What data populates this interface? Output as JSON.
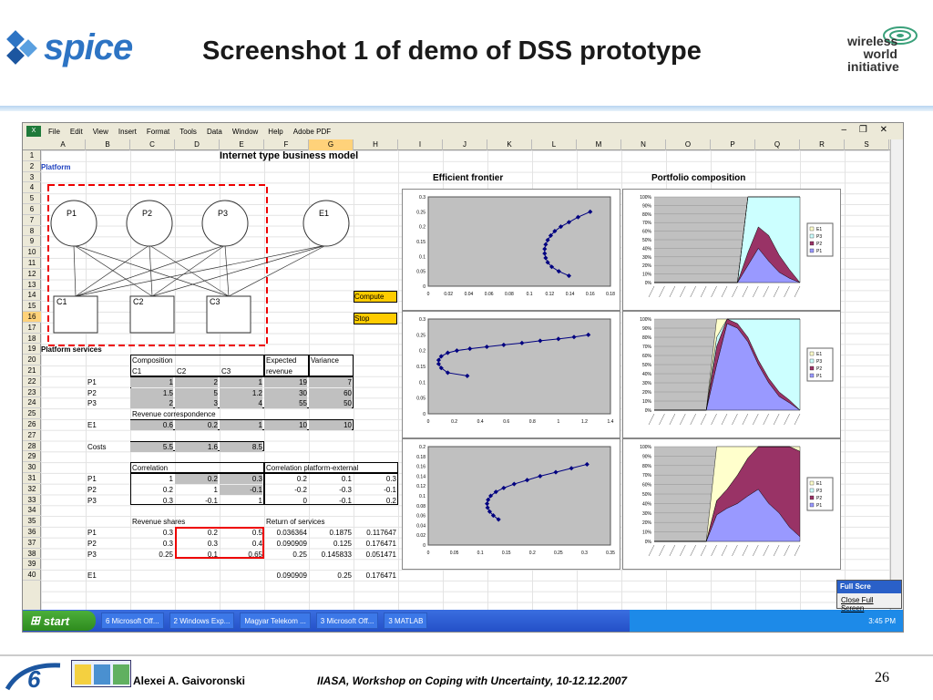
{
  "slide": {
    "title": "Screenshot 1 of demo of DSS prototype",
    "spice_logo": "spice",
    "wwi_logo": [
      "wireless",
      "world",
      "initiative"
    ],
    "author": "Alexei A. Gaivoronski",
    "venue": "IIASA, Workshop on Coping with Uncertainty, 10-12.12.2007",
    "page_number": "26"
  },
  "excel": {
    "menu": [
      "File",
      "Edit",
      "View",
      "Insert",
      "Format",
      "Tools",
      "Data",
      "Window",
      "Help",
      "Adobe PDF"
    ],
    "columns": [
      "A",
      "B",
      "C",
      "D",
      "E",
      "F",
      "G",
      "H",
      "I",
      "J",
      "K",
      "L",
      "M",
      "N",
      "O",
      "P",
      "Q",
      "R",
      "S"
    ],
    "rows": [
      "1",
      "2",
      "3",
      "4",
      "5",
      "6",
      "7",
      "8",
      "9",
      "10",
      "11",
      "12",
      "13",
      "14",
      "15",
      "16",
      "17",
      "18",
      "19",
      "20",
      "21",
      "22",
      "23",
      "24",
      "25",
      "26",
      "27",
      "28",
      "29",
      "30",
      "31",
      "32",
      "33",
      "34",
      "35",
      "36",
      "37",
      "38",
      "39",
      "40"
    ],
    "sheet_title": "Internet type business model",
    "platform_label": "Platform",
    "nodes": {
      "p1": "P1",
      "p2": "P2",
      "p3": "P3",
      "e1": "E1",
      "c1": "C1",
      "c2": "C2",
      "c3": "C3"
    },
    "compute_button": "Compute",
    "stop_button": "Stop",
    "platform_services": "Platform services",
    "composition": "Composition",
    "expected": "Expected",
    "revenue": "revenue",
    "variance": "Variance",
    "comp_cols": [
      "C1",
      "C2",
      "C3"
    ],
    "comp_rows": [
      {
        "label": "P1",
        "vals": [
          "1",
          "2",
          "1"
        ],
        "exp": "19",
        "var": "7"
      },
      {
        "label": "P2",
        "vals": [
          "1.5",
          "5",
          "1.2"
        ],
        "exp": "30",
        "var": "60"
      },
      {
        "label": "P3",
        "vals": [
          "2",
          "3",
          "4"
        ],
        "exp": "55",
        "var": "50"
      }
    ],
    "revenue_correspondence": "Revenue correspondence",
    "e1_row": {
      "label": "E1",
      "vals": [
        "0.6",
        "0.2",
        "1"
      ],
      "exp": "10",
      "var": "10"
    },
    "costs_row": {
      "label": "Costs",
      "vals": [
        "5.5",
        "1.6",
        "8.5"
      ]
    },
    "correlation": "Correlation",
    "correlation_pe": "Correlation platform-external",
    "corr_rows": [
      {
        "label": "P1",
        "vals": [
          "1",
          "0.2",
          "0.3"
        ],
        "ext": [
          "0.2",
          "0.1",
          "0.3"
        ]
      },
      {
        "label": "P2",
        "vals": [
          "0.2",
          "1",
          "-0.1"
        ],
        "ext": [
          "-0.2",
          "-0.3",
          "-0.1"
        ]
      },
      {
        "label": "P3",
        "vals": [
          "0.3",
          "-0.1",
          "1"
        ],
        "ext": [
          "0",
          "-0.1",
          "0.2"
        ]
      }
    ],
    "revenue_shares": "Revenue shares",
    "return_of_services": "Return of services",
    "share_rows": [
      {
        "label": "P1",
        "vals": [
          "0.3",
          "0.2",
          "0.5"
        ],
        "ret": [
          "0.036364",
          "0.1875",
          "0.117647"
        ]
      },
      {
        "label": "P2",
        "vals": [
          "0.3",
          "0.3",
          "0.4"
        ],
        "ret": [
          "0.090909",
          "0.125",
          "0.176471"
        ]
      },
      {
        "label": "P3",
        "vals": [
          "0.25",
          "0.1",
          "0.65"
        ],
        "ret": [
          "0.25",
          "0.145833",
          "0.051471"
        ]
      }
    ],
    "e1_return": {
      "label": "E1",
      "ret": [
        "0.090909",
        "0.25",
        "0.176471"
      ]
    },
    "efficient_frontier_title": "Efficient frontier",
    "portfolio_title": "Portfolio composition",
    "legend": [
      "E1",
      "P3",
      "P2",
      "P1"
    ],
    "colors": {
      "e1": "#ffffcc",
      "p3": "#ccffff",
      "p2": "#993366",
      "p1": "#9999ff",
      "plot_bg": "#c0c0c0",
      "curve": "#000080"
    }
  },
  "chart_data": [
    {
      "type": "scatter",
      "title": "Efficient frontier",
      "xlim": [
        0,
        0.18
      ],
      "ylim": [
        0,
        0.3
      ],
      "x_ticks": [
        "0",
        "0.02",
        "0.04",
        "0.06",
        "0.08",
        "0.1",
        "0.12",
        "0.14",
        "0.16",
        "0.18"
      ],
      "y_ticks": [
        "0",
        "0.05",
        "0.1",
        "0.15",
        "0.2",
        "0.25",
        "0.3"
      ],
      "x": [
        0.139,
        0.129,
        0.122,
        0.118,
        0.116,
        0.115,
        0.115,
        0.116,
        0.118,
        0.121,
        0.125,
        0.131,
        0.139,
        0.148,
        0.16
      ],
      "y": [
        0.035,
        0.05,
        0.065,
        0.08,
        0.095,
        0.11,
        0.125,
        0.14,
        0.155,
        0.17,
        0.185,
        0.2,
        0.215,
        0.232,
        0.25
      ]
    },
    {
      "type": "scatter",
      "xlim": [
        0,
        1.4
      ],
      "ylim": [
        0,
        0.3
      ],
      "x_ticks": [
        "0",
        "0.2",
        "0.4",
        "0.6",
        "0.8",
        "1",
        "1.2",
        "1.4"
      ],
      "y_ticks": [
        "0",
        "0.05",
        "0.1",
        "0.15",
        "0.2",
        "0.25",
        "0.3"
      ],
      "x": [
        0.3,
        0.15,
        0.1,
        0.08,
        0.08,
        0.1,
        0.15,
        0.22,
        0.32,
        0.45,
        0.58,
        0.72,
        0.86,
        1.0,
        1.12,
        1.23
      ],
      "y": [
        0.12,
        0.13,
        0.145,
        0.158,
        0.17,
        0.182,
        0.193,
        0.2,
        0.206,
        0.212,
        0.218,
        0.224,
        0.231,
        0.237,
        0.243,
        0.25
      ]
    },
    {
      "type": "scatter",
      "xlim": [
        0,
        0.35
      ],
      "ylim": [
        0,
        0.2
      ],
      "x_ticks": [
        "0",
        "0.05",
        "0.1",
        "0.15",
        "0.2",
        "0.25",
        "0.3",
        "0.35"
      ],
      "y_ticks": [
        "0",
        "0.02",
        "0.04",
        "0.06",
        "0.08",
        "0.1",
        "0.12",
        "0.14",
        "0.16",
        "0.18",
        "0.2"
      ],
      "x": [
        0.135,
        0.125,
        0.118,
        0.114,
        0.113,
        0.115,
        0.12,
        0.13,
        0.145,
        0.165,
        0.19,
        0.215,
        0.245,
        0.275,
        0.305
      ],
      "y": [
        0.052,
        0.06,
        0.068,
        0.076,
        0.084,
        0.092,
        0.1,
        0.108,
        0.116,
        0.124,
        0.132,
        0.14,
        0.148,
        0.156,
        0.164
      ]
    },
    {
      "type": "area",
      "ylim": [
        0,
        100
      ],
      "y_ticks": [
        "0%",
        "10%",
        "20%",
        "30%",
        "40%",
        "50%",
        "60%",
        "70%",
        "80%",
        "90%",
        "100%"
      ],
      "series": [
        {
          "name": "P1",
          "values": [
            0,
            0,
            0,
            0,
            0,
            0,
            0,
            0,
            0,
            20,
            40,
            25,
            12,
            5,
            0
          ]
        },
        {
          "name": "P2",
          "values": [
            0,
            0,
            0,
            0,
            0,
            0,
            0,
            0,
            0,
            15,
            25,
            30,
            20,
            10,
            0
          ]
        },
        {
          "name": "P3",
          "values": [
            0,
            0,
            0,
            0,
            0,
            0,
            0,
            0,
            0,
            65,
            35,
            45,
            68,
            85,
            100
          ]
        },
        {
          "name": "E1",
          "values": [
            0,
            0,
            0,
            0,
            0,
            0,
            0,
            0,
            0,
            0,
            0,
            0,
            0,
            0,
            0
          ]
        }
      ]
    },
    {
      "type": "area",
      "ylim": [
        0,
        100
      ],
      "y_ticks": [
        "0%",
        "10%",
        "20%",
        "30%",
        "40%",
        "50%",
        "60%",
        "70%",
        "80%",
        "90%",
        "100%"
      ],
      "series": [
        {
          "name": "P1",
          "values": [
            0,
            0,
            0,
            0,
            0,
            0,
            50,
            95,
            90,
            75,
            50,
            30,
            15,
            8,
            0
          ]
        },
        {
          "name": "P2",
          "values": [
            0,
            0,
            0,
            0,
            0,
            0,
            20,
            5,
            5,
            5,
            5,
            5,
            5,
            3,
            0
          ]
        },
        {
          "name": "P3",
          "values": [
            0,
            0,
            0,
            0,
            0,
            0,
            10,
            0,
            5,
            20,
            45,
            65,
            80,
            89,
            100
          ]
        },
        {
          "name": "E1",
          "values": [
            0,
            0,
            0,
            0,
            0,
            0,
            20,
            0,
            0,
            0,
            0,
            0,
            0,
            0,
            0
          ]
        }
      ]
    },
    {
      "type": "area",
      "ylim": [
        0,
        100
      ],
      "y_ticks": [
        "0%",
        "10%",
        "20%",
        "30%",
        "40%",
        "50%",
        "60%",
        "70%",
        "80%",
        "90%",
        "100%"
      ],
      "series": [
        {
          "name": "P1",
          "values": [
            0,
            0,
            0,
            0,
            0,
            0,
            28,
            35,
            40,
            48,
            55,
            40,
            30,
            15,
            5
          ]
        },
        {
          "name": "P2",
          "values": [
            0,
            0,
            0,
            0,
            0,
            0,
            15,
            20,
            30,
            40,
            45,
            60,
            70,
            85,
            90
          ]
        },
        {
          "name": "P3",
          "values": [
            0,
            0,
            0,
            0,
            0,
            0,
            0,
            0,
            0,
            0,
            0,
            0,
            0,
            0,
            0
          ]
        },
        {
          "name": "E1",
          "values": [
            0,
            0,
            0,
            0,
            0,
            0,
            57,
            45,
            30,
            12,
            0,
            0,
            0,
            0,
            5
          ]
        }
      ]
    }
  ],
  "taskbar": {
    "start": "start",
    "tasks": [
      "6 Microsoft Off...",
      "2 Windows Exp...",
      "Magyar Telekom ...",
      "3 Microsoft Off...",
      "3 MATLAB"
    ],
    "clock": "3:45 PM"
  },
  "fullscreen": {
    "title": "Full Scre",
    "button": "Close Full Screen"
  }
}
